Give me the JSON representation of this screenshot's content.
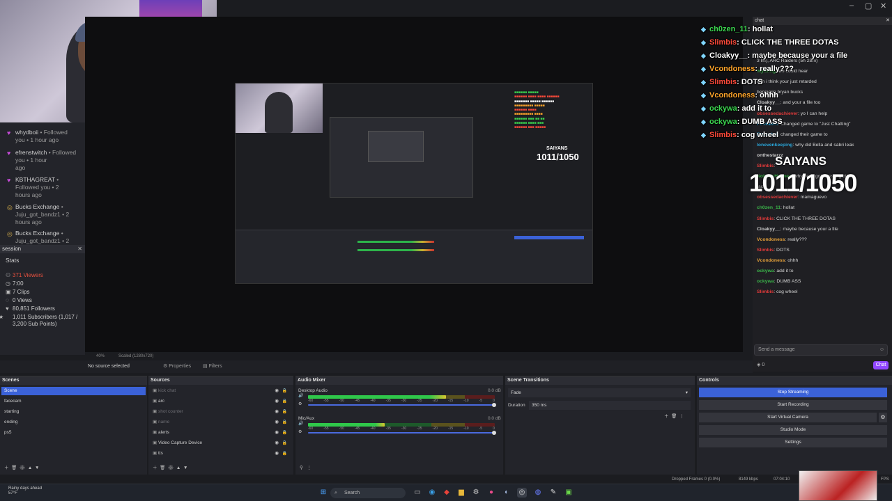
{
  "window": {
    "controls": [
      "–",
      "▢",
      "✕"
    ]
  },
  "followers": [
    {
      "name": "whydboii",
      "text": " • Followed",
      "sub": "you • 1 hour ago",
      "icon": "heart-icon"
    },
    {
      "name": "efrenstwitch",
      "text": " • Followed you • 1 hour",
      "sub": "ago",
      "icon": "heart-icon"
    },
    {
      "name": "KBTHAGREAT",
      "text": " • Followed you • 2",
      "sub": "hours ago",
      "icon": "heart-icon"
    },
    {
      "name": "Bucks Exchange",
      "text": " •",
      "sub": "Juju_got_bandz1 • 2 hours ago",
      "icon": "coin-icon"
    },
    {
      "name": "Bucks Exchange",
      "text": " •",
      "sub": "Juju_got_bandz1 • 2",
      "icon": "coin-icon"
    }
  ],
  "session": {
    "title": "session",
    "tab": "Stats",
    "stats": [
      {
        "icon": "person-icon",
        "text": "371 Viewers",
        "color": "#e9513f"
      },
      {
        "icon": "clock-icon",
        "text": "7:00",
        "color": "#cfcfcf"
      },
      {
        "icon": "clip-icon",
        "text": "7 Clips",
        "color": "#cfcfcf"
      },
      {
        "icon": "views-icon",
        "text": "0 Views",
        "color": "#cfcfcf"
      },
      {
        "icon": "heart-icon",
        "text": "80,851 Followers",
        "color": "#cfcfcf"
      },
      {
        "icon": "star-icon",
        "text": "1,011 Subscribers (1,017 / 3,200 Sub Points)",
        "color": "#cfcfcf"
      }
    ]
  },
  "preview": {
    "zoom": "40%",
    "scaled": "Scaled (1280x720)"
  },
  "source_bar": {
    "no_source": "No source selected",
    "properties": "Properties",
    "filters": "Filters"
  },
  "chat": {
    "header": "chat",
    "messages": [
      {
        "name": "",
        "text": "3 lm), ARC Raiders (5h 28m)",
        "color": "#bbb"
      },
      {
        "name": "mylizing",
        "text": ": we could hear",
        "color": "#3bb54a"
      },
      {
        "name": "",
        "text": "nah i think your just retarded",
        "color": "#bbb"
      },
      {
        "name": "",
        "text": "benjamin bryan bucks",
        "color": "#bbb"
      },
      {
        "name": "Cloakyy__",
        "text": ": and your a file too",
        "color": "#ccc"
      },
      {
        "name": "obsessedachiever",
        "text": ": yo I can help",
        "color": "#e03a3a"
      },
      {
        "name": "Fossabot",
        "text": ": Changed game to \"Just Chatting\"",
        "color": "#2aa5d8"
      },
      {
        "name": "Fossabot",
        "text": ": changed their game to",
        "color": "#2aa5d8"
      },
      {
        "name": "lonevenkeeping",
        "text": ": why did Bella and sabri leak",
        "color": "#2aa5d8"
      },
      {
        "name": "onthestarzz",
        "text": "",
        "color": "#ccc"
      },
      {
        "name": "Slimbis",
        "text": ":",
        "color": "#e03a3a"
      },
      {
        "name": "NobodyHolmes",
        "text": ": why benji got a resting bitch",
        "color": "#3bb54a"
      },
      {
        "name": "",
        "text": "face",
        "color": "#ccc"
      },
      {
        "name": "obsessedachiever",
        "text": ": mamaguevo",
        "color": "#e03a3a"
      },
      {
        "name": "ch0zen_11",
        "text": ": hollat",
        "color": "#3bb54a"
      },
      {
        "name": "Slimbis",
        "text": ": CLICK THE THREE DOTAS",
        "color": "#e03a3a"
      },
      {
        "name": "Cloakyy__",
        "text": ": maybe because your a file",
        "color": "#ccc"
      },
      {
        "name": "Vcondoness",
        "text": ": really???",
        "color": "#e8a33a"
      },
      {
        "name": "Slimbis",
        "text": ": DOTS",
        "color": "#e03a3a"
      },
      {
        "name": "Vcondoness",
        "text": ": ohhh",
        "color": "#e8a33a"
      },
      {
        "name": "ockywa",
        "text": ": add it to",
        "color": "#3bb54a"
      },
      {
        "name": "ockywa",
        "text": ": DUMB ASS",
        "color": "#3bb54a"
      },
      {
        "name": "Slimbis",
        "text": ": cog wheel",
        "color": "#e03a3a"
      }
    ],
    "input_placeholder": "Send a message",
    "send": "Chat",
    "points": "0"
  },
  "overlay": {
    "lines": [
      {
        "name": "ch0zen_11",
        "text": ": hollat",
        "color": "#3bd64f"
      },
      {
        "name": "Slimbis",
        "text": ": CLICK THE THREE DOTAS",
        "color": "#ff4a3a"
      },
      {
        "name": "Cloakyy__",
        "text": ": maybe because your a file",
        "color": "#ffffff"
      },
      {
        "name": "Vcondoness",
        "text": ": really???",
        "color": "#ffa52a"
      },
      {
        "name": "Slimbis",
        "text": ": DOTS",
        "color": "#ff4a3a"
      },
      {
        "name": "Vcondoness",
        "text": ": ohhh",
        "color": "#ffa52a"
      },
      {
        "name": "ockywa",
        "text": ": add it to",
        "color": "#3bd64f"
      },
      {
        "name": "ockywa",
        "text": ": DUMB ASS",
        "color": "#3bd64f"
      },
      {
        "name": "Slimbis",
        "text": ": cog wheel",
        "color": "#ff4a3a"
      }
    ],
    "goal_label": "SAIYANS",
    "goal_count": "1011/1050"
  },
  "scenes": {
    "title": "Scenes",
    "items": [
      "Scene",
      "facecam",
      "starting",
      "ending",
      "ps5"
    ],
    "active": 0
  },
  "sources": {
    "title": "Sources",
    "items": [
      {
        "label": "kick chat",
        "dim": true
      },
      {
        "label": "arc",
        "dim": false
      },
      {
        "label": "shot counter",
        "dim": true
      },
      {
        "label": "name",
        "dim": true
      },
      {
        "label": "alerts",
        "dim": false
      },
      {
        "label": "Video Capture Device",
        "dim": false
      },
      {
        "label": "tts",
        "dim": false
      }
    ]
  },
  "mixer": {
    "title": "Audio Mixer",
    "channels": [
      {
        "name": "Desktop Audio",
        "db": "0.0 dB",
        "level": 0.74
      },
      {
        "name": "Mic/Aux",
        "db": "0.0 dB",
        "level": 0.41
      }
    ],
    "ticks": [
      "-60",
      "-55",
      "-50",
      "-45",
      "-40",
      "-35",
      "-30",
      "-25",
      "-20",
      "-15",
      "-10",
      "-5",
      "0"
    ]
  },
  "transitions": {
    "title": "Scene Transitions",
    "type": "Fade",
    "duration_label": "Duration",
    "duration": "350 ms"
  },
  "controls": {
    "title": "Controls",
    "buttons": [
      "Stop Streaming",
      "Start Recording",
      "Start Virtual Camera",
      "Studio Mode",
      "Settings"
    ]
  },
  "statusbar": {
    "dropped": "Dropped Frames 0 (0.0%)",
    "kbps": "8149 kbps",
    "time": "07:04:10",
    "fps": "FPS"
  },
  "taskbar": {
    "search": "Search",
    "weather_line1": "Rainy days ahead",
    "weather_line2": "57°F"
  }
}
